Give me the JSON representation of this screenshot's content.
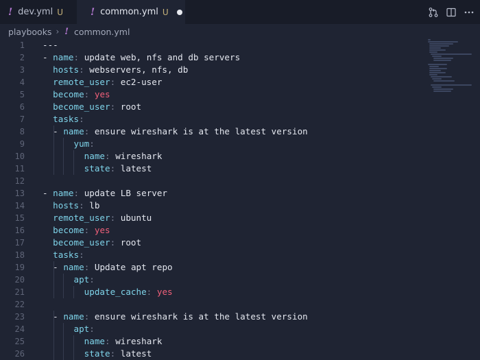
{
  "tabs": [
    {
      "icon": "!",
      "label": "dev.yml",
      "status": "U",
      "active": false
    },
    {
      "icon": "!",
      "label": "common.yml",
      "status": "U",
      "active": true,
      "dirty": true
    }
  ],
  "breadcrumb": {
    "folder": "playbooks",
    "icon": "!",
    "file": "common.yml"
  },
  "editor": {
    "line_numbers": [
      "1",
      "2",
      "3",
      "4",
      "5",
      "6",
      "7",
      "8",
      "9",
      "10",
      "11",
      "12",
      "13",
      "14",
      "15",
      "16",
      "17",
      "18",
      "19",
      "20",
      "21",
      "22",
      "23",
      "24",
      "25",
      "26"
    ],
    "lines": [
      {
        "indent": 0,
        "dash": false,
        "raw": "---"
      },
      {
        "indent": 0,
        "dash": true,
        "key": "name",
        "value": "update web, nfs and db servers",
        "vtype": "str"
      },
      {
        "indent": 1,
        "dash": false,
        "key": "hosts",
        "value": "webservers, nfs, db",
        "vtype": "str"
      },
      {
        "indent": 1,
        "dash": false,
        "key": "remote_user",
        "value": "ec2-user",
        "vtype": "str"
      },
      {
        "indent": 1,
        "dash": false,
        "key": "become",
        "value": "yes",
        "vtype": "bool"
      },
      {
        "indent": 1,
        "dash": false,
        "key": "become_user",
        "value": "root",
        "vtype": "str"
      },
      {
        "indent": 1,
        "dash": false,
        "key": "tasks",
        "value": "",
        "vtype": "none"
      },
      {
        "indent": 2,
        "dash": true,
        "key": "name",
        "value": "ensure wireshark is at the latest version",
        "vtype": "str"
      },
      {
        "indent": 3,
        "dash": false,
        "key": "yum",
        "value": "",
        "vtype": "none"
      },
      {
        "indent": 4,
        "dash": false,
        "key": "name",
        "value": "wireshark",
        "vtype": "str"
      },
      {
        "indent": 4,
        "dash": false,
        "key": "state",
        "value": "latest",
        "vtype": "str"
      },
      {
        "indent": 0,
        "dash": false,
        "raw": ""
      },
      {
        "indent": 0,
        "dash": true,
        "key": "name",
        "value": "update LB server",
        "vtype": "str"
      },
      {
        "indent": 1,
        "dash": false,
        "key": "hosts",
        "value": "lb",
        "vtype": "str"
      },
      {
        "indent": 1,
        "dash": false,
        "key": "remote_user",
        "value": "ubuntu",
        "vtype": "str"
      },
      {
        "indent": 1,
        "dash": false,
        "key": "become",
        "value": "yes",
        "vtype": "bool"
      },
      {
        "indent": 1,
        "dash": false,
        "key": "become_user",
        "value": "root",
        "vtype": "str"
      },
      {
        "indent": 1,
        "dash": false,
        "key": "tasks",
        "value": "",
        "vtype": "none"
      },
      {
        "indent": 2,
        "dash": true,
        "key": "name",
        "value": "Update apt repo",
        "vtype": "str"
      },
      {
        "indent": 3,
        "dash": false,
        "key": "apt",
        "value": "",
        "vtype": "none"
      },
      {
        "indent": 4,
        "dash": false,
        "key": "update_cache",
        "value": "yes",
        "vtype": "bool"
      },
      {
        "indent": 0,
        "dash": false,
        "raw": ""
      },
      {
        "indent": 2,
        "dash": true,
        "key": "name",
        "value": "ensure wireshark is at the latest version",
        "vtype": "str"
      },
      {
        "indent": 3,
        "dash": false,
        "key": "apt",
        "value": "",
        "vtype": "none"
      },
      {
        "indent": 4,
        "dash": false,
        "key": "name",
        "value": "wireshark",
        "vtype": "str"
      },
      {
        "indent": 4,
        "dash": false,
        "key": "state",
        "value": "latest",
        "vtype": "str"
      }
    ]
  },
  "actions": [
    "source-control-icon",
    "split-editor-icon",
    "more-actions-icon"
  ],
  "colors": {
    "key": "#7fd4ea",
    "bool": "#f0607a",
    "yaml_icon": "#b87bd6",
    "modified": "#c6b27a"
  }
}
